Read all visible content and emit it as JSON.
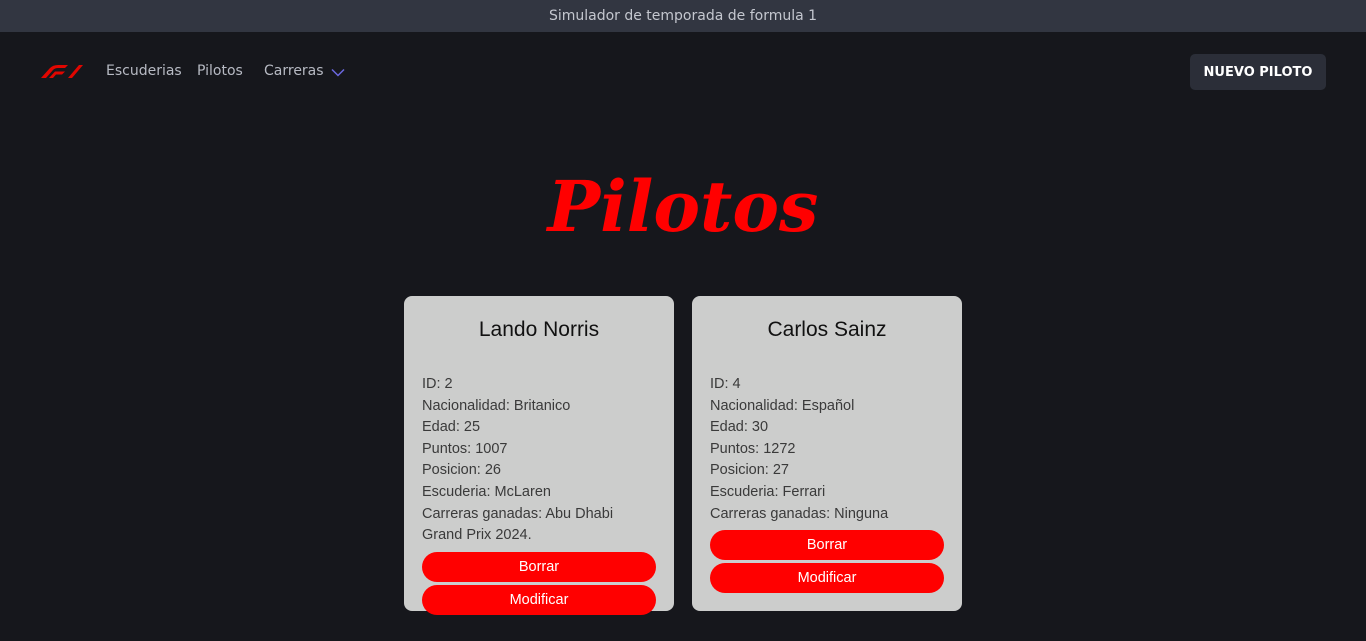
{
  "window": {
    "title": "Simulador de temporada de formula 1"
  },
  "nav": {
    "links": [
      "Escuderias",
      "Pilotos",
      "Carreras"
    ],
    "new_button": "NUEVO PILOTO"
  },
  "page": {
    "title": "Pilotos"
  },
  "colors": {
    "accent": "#ff0000",
    "background": "#16171c",
    "card": "#cccdcc"
  },
  "drivers": [
    {
      "name": "Lando Norris",
      "id_line": "ID: 2",
      "nationality_line": "Nacionalidad: Britanico",
      "age_line": "Edad: 25",
      "points_line": "Puntos: 1007",
      "position_line": "Posicion: 26",
      "team_line": "Escuderia: McLaren",
      "wins_line": "Carreras ganadas: Abu Dhabi Grand Prix 2024.",
      "delete_label": "Borrar",
      "edit_label": "Modificar"
    },
    {
      "name": "Carlos Sainz",
      "id_line": "ID: 4",
      "nationality_line": "Nacionalidad: Español",
      "age_line": "Edad: 30",
      "points_line": "Puntos: 1272",
      "position_line": "Posicion: 27",
      "team_line": "Escuderia: Ferrari",
      "wins_line": "Carreras ganadas: Ninguna",
      "delete_label": "Borrar",
      "edit_label": "Modificar"
    }
  ]
}
